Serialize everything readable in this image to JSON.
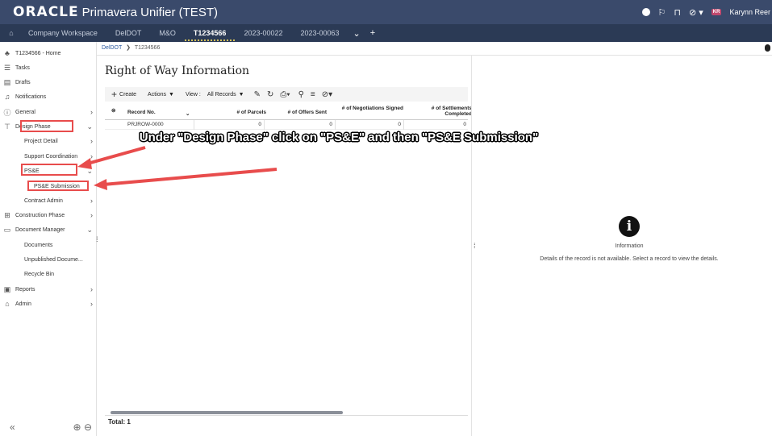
{
  "header": {
    "brand_oracle": "ORACLE",
    "brand_rest": "Primavera Unifier (TEST)",
    "avatar_initials": "KR",
    "user_name": "Karynn Reer",
    "bg_color": "#3a4a6b"
  },
  "tabs": {
    "items": [
      "Company Workspace",
      "DelDOT",
      "M&O",
      "T1234566",
      "2023-00022",
      "2023-00063"
    ],
    "active": "T1234566",
    "more": "⌄",
    "add": "+"
  },
  "sidebar": {
    "items": [
      {
        "label": "T1234566 - Home",
        "icon": "hierarchy-icon"
      },
      {
        "label": "Tasks",
        "icon": "tasks-icon"
      },
      {
        "label": "Drafts",
        "icon": "drafts-icon"
      },
      {
        "label": "Notifications",
        "icon": "bell-icon"
      },
      {
        "label": "General",
        "icon": "info-icon"
      },
      {
        "label": "Design Phase",
        "icon": "compass-icon"
      },
      {
        "label": "Project Detail"
      },
      {
        "label": "Support Coordination"
      },
      {
        "label": "PS&E"
      },
      {
        "label": "PS&E Submission"
      },
      {
        "label": "Contract Admin"
      },
      {
        "label": "Construction Phase",
        "icon": "construction-icon"
      },
      {
        "label": "Document Manager",
        "icon": "folder-icon"
      },
      {
        "label": "Documents"
      },
      {
        "label": "Unpublished Docume..."
      },
      {
        "label": "Recycle Bin"
      },
      {
        "label": "Reports",
        "icon": "reports-icon"
      },
      {
        "label": "Admin",
        "icon": "lock-icon"
      }
    ]
  },
  "breadcrumb": {
    "root": "DelDOT",
    "current": "T1234566"
  },
  "main": {
    "title": "Right of Way Information",
    "toolbar": {
      "create": "Create",
      "actions": "Actions",
      "view_label": "View :",
      "view_value": "All Records"
    },
    "columns": [
      "Record No.",
      "# of Parcels",
      "# of Offers Sent",
      "# of Negotiations Signed",
      "# of Settlements Completed"
    ],
    "rows": [
      {
        "record_no": "PRJROW-0000",
        "parcels": "0",
        "offers": "0",
        "negotiations": "0",
        "settlements": "0"
      }
    ],
    "total": "Total: 1"
  },
  "info_panel": {
    "title": "Information",
    "message": "Details of the record is not available. Select a record to view the details."
  },
  "annotation": {
    "text": "Under \"Design Phase\" click on \"PS&E\" and then \"PS&E Submission\"",
    "color": "#e84c4c"
  }
}
